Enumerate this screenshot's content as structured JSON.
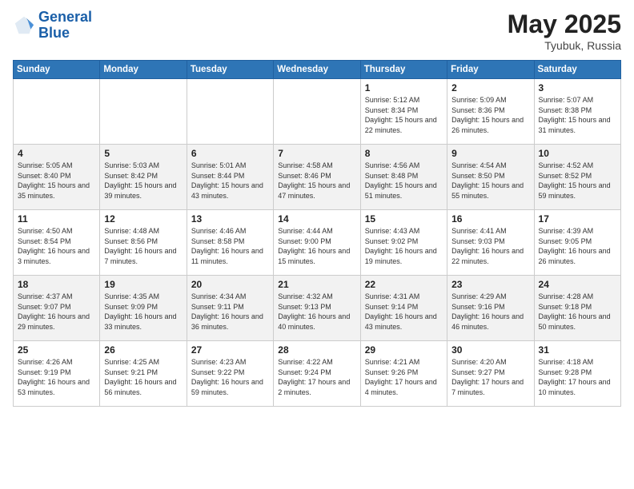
{
  "logo": {
    "line1": "General",
    "line2": "Blue"
  },
  "title": {
    "month_year": "May 2025",
    "location": "Tyubuk, Russia"
  },
  "weekdays": [
    "Sunday",
    "Monday",
    "Tuesday",
    "Wednesday",
    "Thursday",
    "Friday",
    "Saturday"
  ],
  "rows": [
    [
      {
        "day": "",
        "info": ""
      },
      {
        "day": "",
        "info": ""
      },
      {
        "day": "",
        "info": ""
      },
      {
        "day": "",
        "info": ""
      },
      {
        "day": "1",
        "info": "Sunrise: 5:12 AM\nSunset: 8:34 PM\nDaylight: 15 hours\nand 22 minutes."
      },
      {
        "day": "2",
        "info": "Sunrise: 5:09 AM\nSunset: 8:36 PM\nDaylight: 15 hours\nand 26 minutes."
      },
      {
        "day": "3",
        "info": "Sunrise: 5:07 AM\nSunset: 8:38 PM\nDaylight: 15 hours\nand 31 minutes."
      }
    ],
    [
      {
        "day": "4",
        "info": "Sunrise: 5:05 AM\nSunset: 8:40 PM\nDaylight: 15 hours\nand 35 minutes."
      },
      {
        "day": "5",
        "info": "Sunrise: 5:03 AM\nSunset: 8:42 PM\nDaylight: 15 hours\nand 39 minutes."
      },
      {
        "day": "6",
        "info": "Sunrise: 5:01 AM\nSunset: 8:44 PM\nDaylight: 15 hours\nand 43 minutes."
      },
      {
        "day": "7",
        "info": "Sunrise: 4:58 AM\nSunset: 8:46 PM\nDaylight: 15 hours\nand 47 minutes."
      },
      {
        "day": "8",
        "info": "Sunrise: 4:56 AM\nSunset: 8:48 PM\nDaylight: 15 hours\nand 51 minutes."
      },
      {
        "day": "9",
        "info": "Sunrise: 4:54 AM\nSunset: 8:50 PM\nDaylight: 15 hours\nand 55 minutes."
      },
      {
        "day": "10",
        "info": "Sunrise: 4:52 AM\nSunset: 8:52 PM\nDaylight: 15 hours\nand 59 minutes."
      }
    ],
    [
      {
        "day": "11",
        "info": "Sunrise: 4:50 AM\nSunset: 8:54 PM\nDaylight: 16 hours\nand 3 minutes."
      },
      {
        "day": "12",
        "info": "Sunrise: 4:48 AM\nSunset: 8:56 PM\nDaylight: 16 hours\nand 7 minutes."
      },
      {
        "day": "13",
        "info": "Sunrise: 4:46 AM\nSunset: 8:58 PM\nDaylight: 16 hours\nand 11 minutes."
      },
      {
        "day": "14",
        "info": "Sunrise: 4:44 AM\nSunset: 9:00 PM\nDaylight: 16 hours\nand 15 minutes."
      },
      {
        "day": "15",
        "info": "Sunrise: 4:43 AM\nSunset: 9:02 PM\nDaylight: 16 hours\nand 19 minutes."
      },
      {
        "day": "16",
        "info": "Sunrise: 4:41 AM\nSunset: 9:03 PM\nDaylight: 16 hours\nand 22 minutes."
      },
      {
        "day": "17",
        "info": "Sunrise: 4:39 AM\nSunset: 9:05 PM\nDaylight: 16 hours\nand 26 minutes."
      }
    ],
    [
      {
        "day": "18",
        "info": "Sunrise: 4:37 AM\nSunset: 9:07 PM\nDaylight: 16 hours\nand 29 minutes."
      },
      {
        "day": "19",
        "info": "Sunrise: 4:35 AM\nSunset: 9:09 PM\nDaylight: 16 hours\nand 33 minutes."
      },
      {
        "day": "20",
        "info": "Sunrise: 4:34 AM\nSunset: 9:11 PM\nDaylight: 16 hours\nand 36 minutes."
      },
      {
        "day": "21",
        "info": "Sunrise: 4:32 AM\nSunset: 9:13 PM\nDaylight: 16 hours\nand 40 minutes."
      },
      {
        "day": "22",
        "info": "Sunrise: 4:31 AM\nSunset: 9:14 PM\nDaylight: 16 hours\nand 43 minutes."
      },
      {
        "day": "23",
        "info": "Sunrise: 4:29 AM\nSunset: 9:16 PM\nDaylight: 16 hours\nand 46 minutes."
      },
      {
        "day": "24",
        "info": "Sunrise: 4:28 AM\nSunset: 9:18 PM\nDaylight: 16 hours\nand 50 minutes."
      }
    ],
    [
      {
        "day": "25",
        "info": "Sunrise: 4:26 AM\nSunset: 9:19 PM\nDaylight: 16 hours\nand 53 minutes."
      },
      {
        "day": "26",
        "info": "Sunrise: 4:25 AM\nSunset: 9:21 PM\nDaylight: 16 hours\nand 56 minutes."
      },
      {
        "day": "27",
        "info": "Sunrise: 4:23 AM\nSunset: 9:22 PM\nDaylight: 16 hours\nand 59 minutes."
      },
      {
        "day": "28",
        "info": "Sunrise: 4:22 AM\nSunset: 9:24 PM\nDaylight: 17 hours\nand 2 minutes."
      },
      {
        "day": "29",
        "info": "Sunrise: 4:21 AM\nSunset: 9:26 PM\nDaylight: 17 hours\nand 4 minutes."
      },
      {
        "day": "30",
        "info": "Sunrise: 4:20 AM\nSunset: 9:27 PM\nDaylight: 17 hours\nand 7 minutes."
      },
      {
        "day": "31",
        "info": "Sunrise: 4:18 AM\nSunset: 9:28 PM\nDaylight: 17 hours\nand 10 minutes."
      }
    ]
  ]
}
